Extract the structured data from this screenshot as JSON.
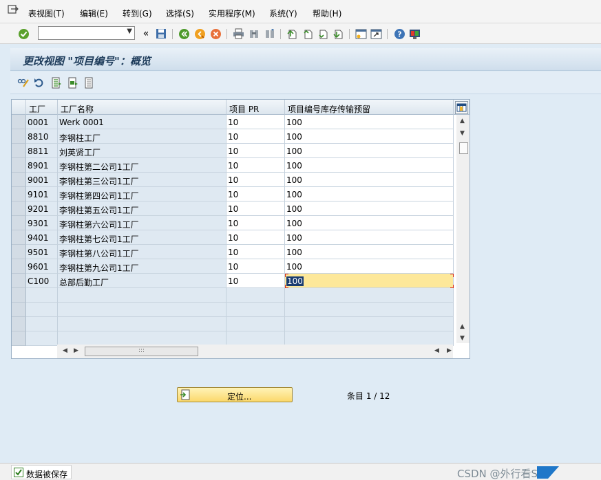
{
  "menubar": {
    "items": [
      "表视图(T)",
      "编辑(E)",
      "转到(G)",
      "选择(S)",
      "实用程序(M)",
      "系统(Y)",
      "帮助(H)"
    ]
  },
  "toolbar": {
    "command_value": "",
    "icons": [
      "enter-icon",
      "save-icon",
      "back-icon",
      "exit-icon",
      "cancel-icon",
      "print-icon",
      "find-icon",
      "find-next-icon",
      "first-page-icon",
      "previous-page-icon",
      "next-page-icon",
      "last-page-icon",
      "new-session-icon",
      "shortcut-icon",
      "help-icon",
      "customize-layout-icon"
    ],
    "collapse_glyph": "«"
  },
  "title": "更改视图 \"项目编号\"：概览",
  "app_toolbar": {
    "icons": [
      "display-change-icon",
      "undo-icon",
      "select-all-icon",
      "select-block-icon",
      "deselect-all-icon"
    ]
  },
  "table": {
    "columns": [
      "工厂",
      "工厂名称",
      "项目 PR",
      "项目编号库存传输预留"
    ],
    "rows": [
      {
        "plant": "0001",
        "name": "Werk 0001",
        "item_pr": "10",
        "item_no": "100"
      },
      {
        "plant": "8810",
        "name": "李钢柱工厂",
        "item_pr": "10",
        "item_no": "100"
      },
      {
        "plant": "8811",
        "name": "刘英贤工厂",
        "item_pr": "10",
        "item_no": "100"
      },
      {
        "plant": "8901",
        "name": "李钢柱第二公司1工厂",
        "item_pr": "10",
        "item_no": "100"
      },
      {
        "plant": "9001",
        "name": "李钢柱第三公司1工厂",
        "item_pr": "10",
        "item_no": "100"
      },
      {
        "plant": "9101",
        "name": "李钢柱第四公司1工厂",
        "item_pr": "10",
        "item_no": "100"
      },
      {
        "plant": "9201",
        "name": "李钢柱第五公司1工厂",
        "item_pr": "10",
        "item_no": "100"
      },
      {
        "plant": "9301",
        "name": "李钢柱第六公司1工厂",
        "item_pr": "10",
        "item_no": "100"
      },
      {
        "plant": "9401",
        "name": "李钢柱第七公司1工厂",
        "item_pr": "10",
        "item_no": "100"
      },
      {
        "plant": "9501",
        "name": "李钢柱第八公司1工厂",
        "item_pr": "10",
        "item_no": "100"
      },
      {
        "plant": "9601",
        "name": "李钢柱第九公司1工厂",
        "item_pr": "10",
        "item_no": "100"
      },
      {
        "plant": "C100",
        "name": "总部后勤工厂",
        "item_pr": "10",
        "item_no": "100"
      }
    ],
    "empty_rows": 4,
    "thumb_glyph": ":::"
  },
  "position_button": "定位...",
  "entry_info": "条目 1 / 12",
  "status": {
    "message": "数据被保存",
    "watermark": "CSDN @外行看SAP"
  },
  "colors": {
    "accent": "#1d3b5a",
    "highlight": "#fde89a",
    "selection": "#1a3c70",
    "focus": "#d4281c"
  }
}
